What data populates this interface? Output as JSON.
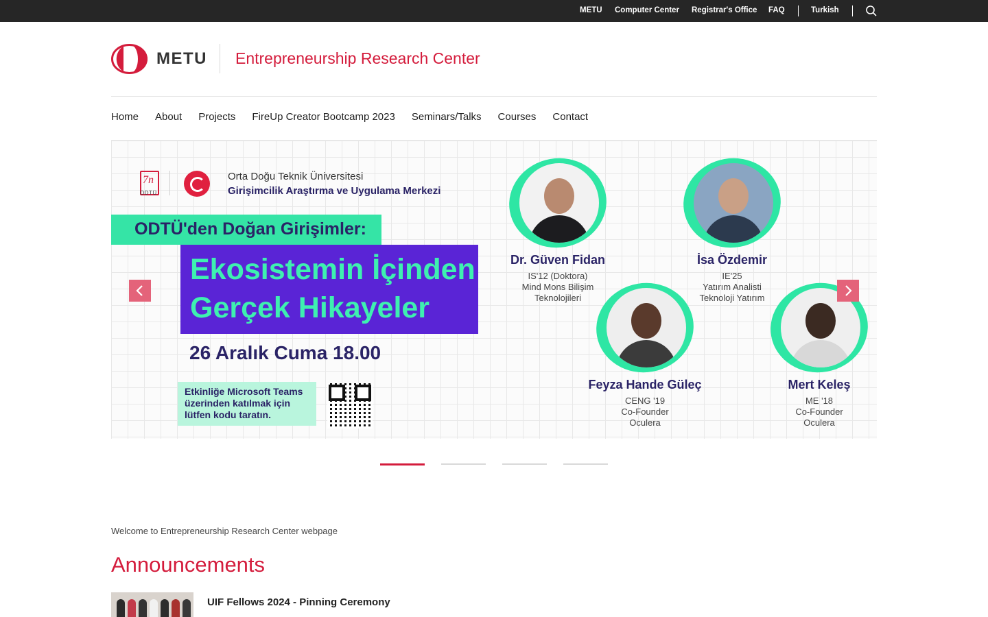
{
  "topbar": {
    "links": [
      "METU",
      "Computer Center",
      "Registrar's Office",
      "FAQ"
    ],
    "language": "Turkish",
    "search_icon": "search-icon"
  },
  "header": {
    "logo_text": "METU",
    "site_title": "Entrepreneurship Research Center"
  },
  "nav": {
    "items": [
      "Home",
      "About",
      "Projects",
      "FireUp Creator Bootcamp 2023",
      "Seminars/Talks",
      "Courses",
      "Contact"
    ]
  },
  "slide": {
    "badge_caption": "ODTÜ",
    "university_line1": "Orta Doğu Teknik Üniversitesi",
    "university_line2": "Girişimcilik Araştırma ve Uygulama Merkezi",
    "banner": "ODTÜ'den Doğan Girişimler:",
    "headline_line1": "Ekosistemin İçinden",
    "headline_line2": "Gerçek Hikayeler",
    "date": "26 Aralık Cuma 18.00",
    "teams_note": "Etkinliğe Microsoft Teams\nüzerinden katılmak için\nlütfen kodu taratın.",
    "speakers": [
      {
        "name": "Dr. Güven Fidan",
        "meta": "IS'12 (Doktora)\nMind Mons Bilişim\nTeknolojileri"
      },
      {
        "name": "İsa Özdemir",
        "meta": "IE'25\nYatırım Analisti\nTeknoloji Yatırım"
      },
      {
        "name": "Feyza Hande Güleç",
        "meta": "CENG '19\nCo-Founder\nOculera"
      },
      {
        "name": "Mert Keleş",
        "meta": "ME '18\nCo-Founder\nOculera"
      }
    ]
  },
  "slider": {
    "active_index": 0,
    "slide_count": 4
  },
  "content": {
    "welcome": "Welcome to Entrepreneurship Research Center webpage",
    "announcements_title": "Announcements",
    "announcements": [
      {
        "title": "UIF Fellows 2024 - Pinning Ceremony"
      }
    ]
  },
  "colors": {
    "brand_red": "#d41c3c",
    "topbar": "#262626",
    "accent_green": "#35e4a6",
    "accent_purple": "#5a24d6"
  }
}
